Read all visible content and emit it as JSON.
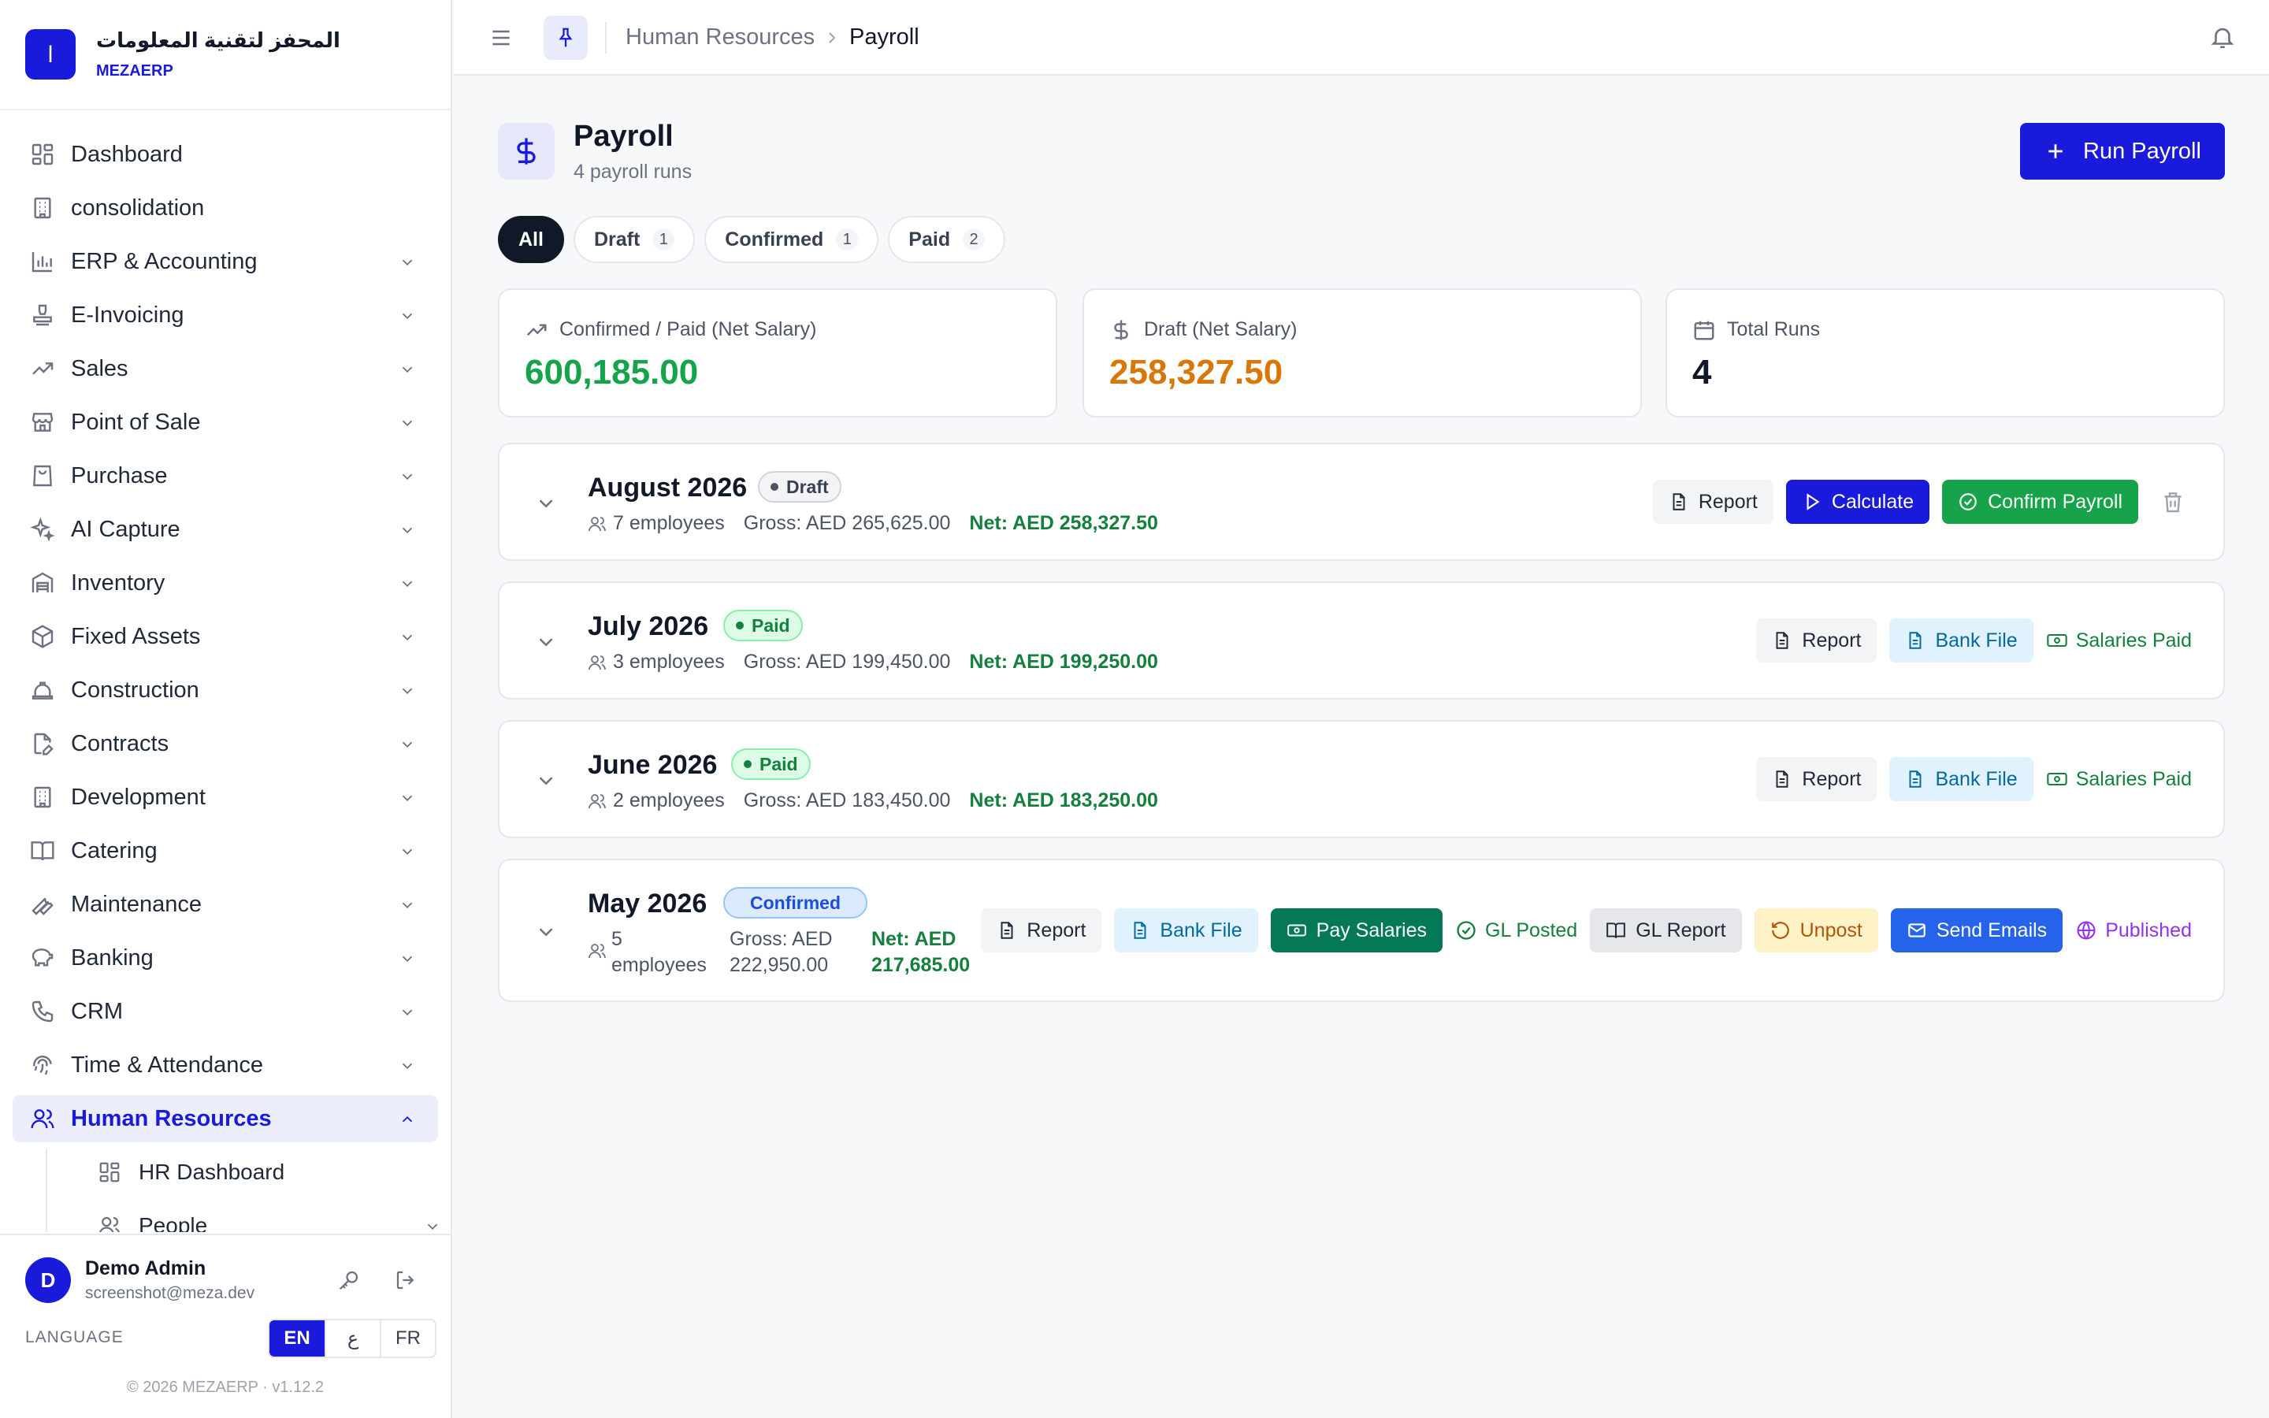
{
  "brand": {
    "logo_letter": "ا",
    "name": "المحفز لتقنية المعلومات",
    "sub": "MEZAERP"
  },
  "sidebar": {
    "items": [
      {
        "label": "Dashboard",
        "icon": "dashboard-icon"
      },
      {
        "label": "consolidation",
        "icon": "building-icon"
      },
      {
        "label": "ERP & Accounting",
        "icon": "bar-chart-icon"
      },
      {
        "label": "E-Invoicing",
        "icon": "stamp-icon"
      },
      {
        "label": "Sales",
        "icon": "trending-up-icon"
      },
      {
        "label": "Point of Sale",
        "icon": "store-icon"
      },
      {
        "label": "Purchase",
        "icon": "shopping-bag-icon"
      },
      {
        "label": "AI Capture",
        "icon": "sparkles-icon"
      },
      {
        "label": "Inventory",
        "icon": "warehouse-icon"
      },
      {
        "label": "Fixed Assets",
        "icon": "box-icon"
      },
      {
        "label": "Construction",
        "icon": "hard-hat-icon"
      },
      {
        "label": "Contracts",
        "icon": "file-pen-icon"
      },
      {
        "label": "Development",
        "icon": "building-icon"
      },
      {
        "label": "Catering",
        "icon": "book-open-icon"
      },
      {
        "label": "Maintenance",
        "icon": "wrench-icon"
      },
      {
        "label": "Banking",
        "icon": "piggy-bank-icon"
      },
      {
        "label": "CRM",
        "icon": "phone-icon"
      },
      {
        "label": "Time & Attendance",
        "icon": "fingerprint-icon"
      },
      {
        "label": "Human Resources",
        "icon": "users-icon",
        "active": true
      }
    ],
    "sub_items": [
      {
        "label": "HR Dashboard",
        "icon": "dashboard-icon"
      },
      {
        "label": "People",
        "icon": "users-icon"
      }
    ]
  },
  "user": {
    "initial": "D",
    "name": "Demo Admin",
    "email": "screenshot@meza.dev"
  },
  "language": {
    "label": "LANGUAGE",
    "options": [
      "EN",
      "ع",
      "FR"
    ],
    "active": "EN"
  },
  "copyright": "© 2026 MEZAERP · v1.12.2",
  "breadcrumb": {
    "parent": "Human Resources",
    "current": "Payroll"
  },
  "page": {
    "title": "Payroll",
    "subtitle": "4 payroll runs",
    "run_button": "Run Payroll"
  },
  "filters": [
    {
      "label": "All",
      "count": null,
      "active": true
    },
    {
      "label": "Draft",
      "count": "1"
    },
    {
      "label": "Confirmed",
      "count": "1"
    },
    {
      "label": "Paid",
      "count": "2"
    }
  ],
  "stats": [
    {
      "label": "Confirmed / Paid (Net Salary)",
      "value": "600,185.00",
      "color": "#16a34a",
      "icon": "trending-up-icon"
    },
    {
      "label": "Draft (Net Salary)",
      "value": "258,327.50",
      "color": "#d97706",
      "icon": "dollar-icon"
    },
    {
      "label": "Total Runs",
      "value": "4",
      "color": "#111827",
      "icon": "calendar-icon"
    }
  ],
  "runs": [
    {
      "title": "August 2026",
      "status": "Draft",
      "employees": "7 employees",
      "gross": "Gross: AED 265,625.00",
      "net": "Net: AED 258,327.50",
      "actions": {
        "report": "Report",
        "calculate": "Calculate",
        "confirm": "Confirm Payroll"
      }
    },
    {
      "title": "July 2026",
      "status": "Paid",
      "employees": "3 employees",
      "gross": "Gross: AED 199,450.00",
      "net": "Net: AED 199,250.00",
      "actions": {
        "report": "Report",
        "bank_file": "Bank File",
        "salaries_paid": "Salaries Paid"
      }
    },
    {
      "title": "June 2026",
      "status": "Paid",
      "employees": "2 employees",
      "gross": "Gross: AED 183,450.00",
      "net": "Net: AED 183,250.00",
      "actions": {
        "report": "Report",
        "bank_file": "Bank File",
        "salaries_paid": "Salaries Paid"
      }
    },
    {
      "title": "May 2026",
      "status": "Confirmed",
      "employees_line1": "5",
      "employees_line2": "employees",
      "gross_line1": "Gross: AED",
      "gross_line2": "222,950.00",
      "net_line1": "Net: AED",
      "net_line2": "217,685.00",
      "actions": {
        "report": "Report",
        "bank_file": "Bank File",
        "pay_salaries": "Pay Salaries",
        "gl_posted": "GL Posted",
        "gl_report": "GL Report",
        "unpost": "Unpost",
        "send_emails": "Send Emails",
        "published": "Published"
      }
    }
  ]
}
